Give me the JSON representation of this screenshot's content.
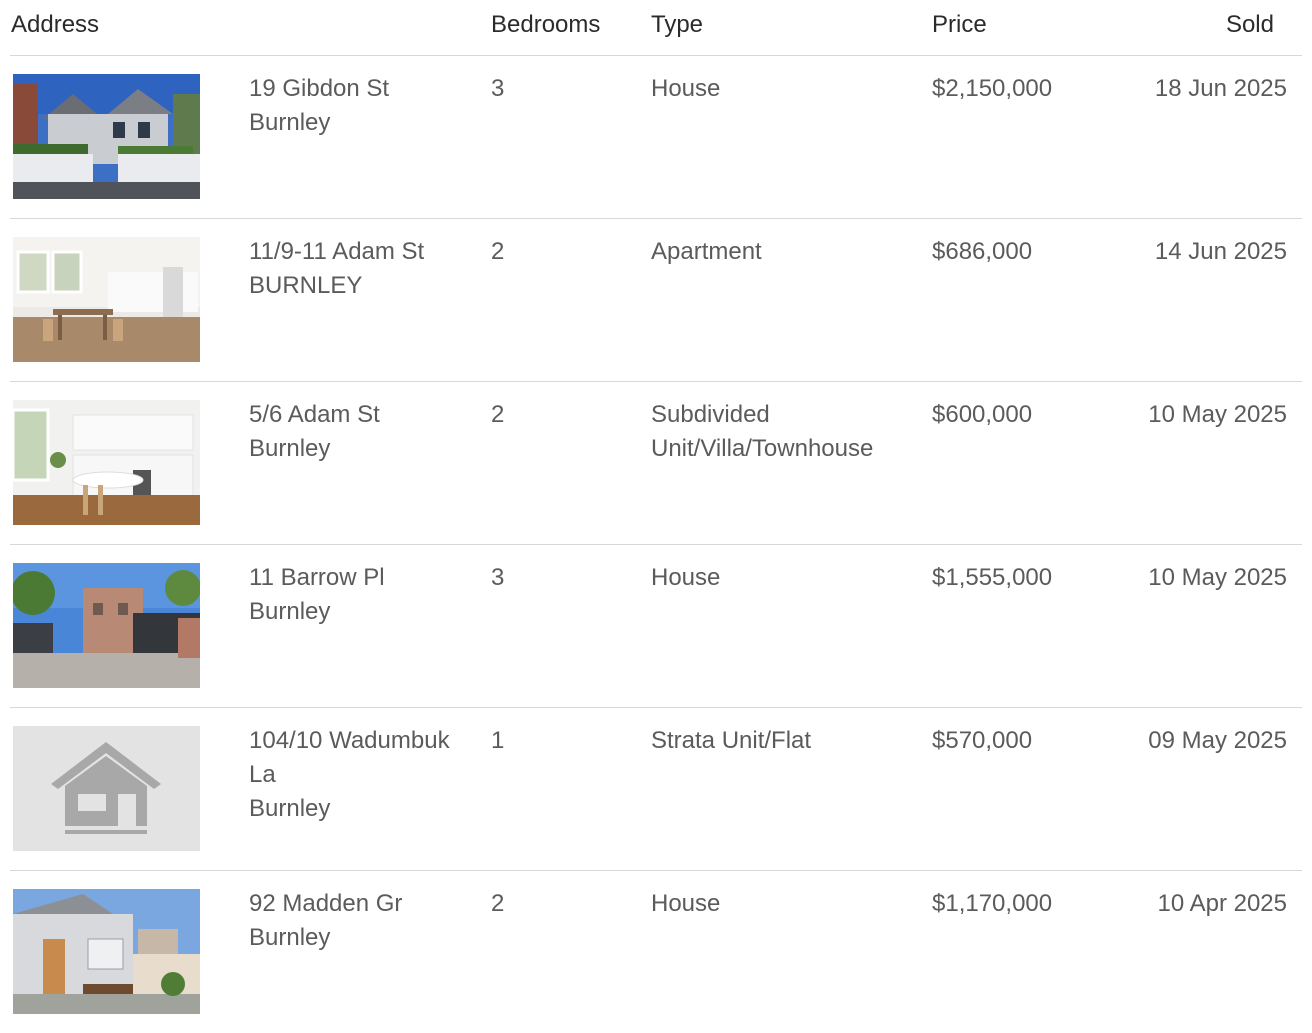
{
  "columns": {
    "address": "Address",
    "bedrooms": "Bedrooms",
    "type": "Type",
    "price": "Price",
    "sold": "Sold"
  },
  "rows": [
    {
      "street": "19 Gibdon St",
      "suburb": "Burnley",
      "bedrooms": "3",
      "type": "House",
      "price": "$2,150,000",
      "sold": "18 Jun 2025",
      "photo": "house-exterior"
    },
    {
      "street": "11/9-11 Adam St",
      "suburb": "BURNLEY",
      "bedrooms": "2",
      "type": "Apartment",
      "price": "$686,000",
      "sold": "14 Jun 2025",
      "photo": "dining-kitchen"
    },
    {
      "street": "5/6 Adam St",
      "suburb": "Burnley",
      "bedrooms": "2",
      "type": "Subdivided Unit/Villa/Townhouse",
      "price": "$600,000",
      "sold": "10 May 2025",
      "photo": "white-kitchen"
    },
    {
      "street": "11 Barrow Pl",
      "suburb": "Burnley",
      "bedrooms": "3",
      "type": "House",
      "price": "$1,555,000",
      "sold": "10 May 2025",
      "photo": "courtyard-garage"
    },
    {
      "street": "104/10 Wadumbuk La",
      "suburb": "Burnley",
      "bedrooms": "1",
      "type": "Strata Unit/Flat",
      "price": "$570,000",
      "sold": "09 May 2025",
      "photo": "placeholder-house-icon"
    },
    {
      "street": "92 Madden Gr",
      "suburb": "Burnley",
      "bedrooms": "2",
      "type": "House",
      "price": "$1,170,000",
      "sold": "10 Apr 2025",
      "photo": "rear-courtyard"
    }
  ]
}
